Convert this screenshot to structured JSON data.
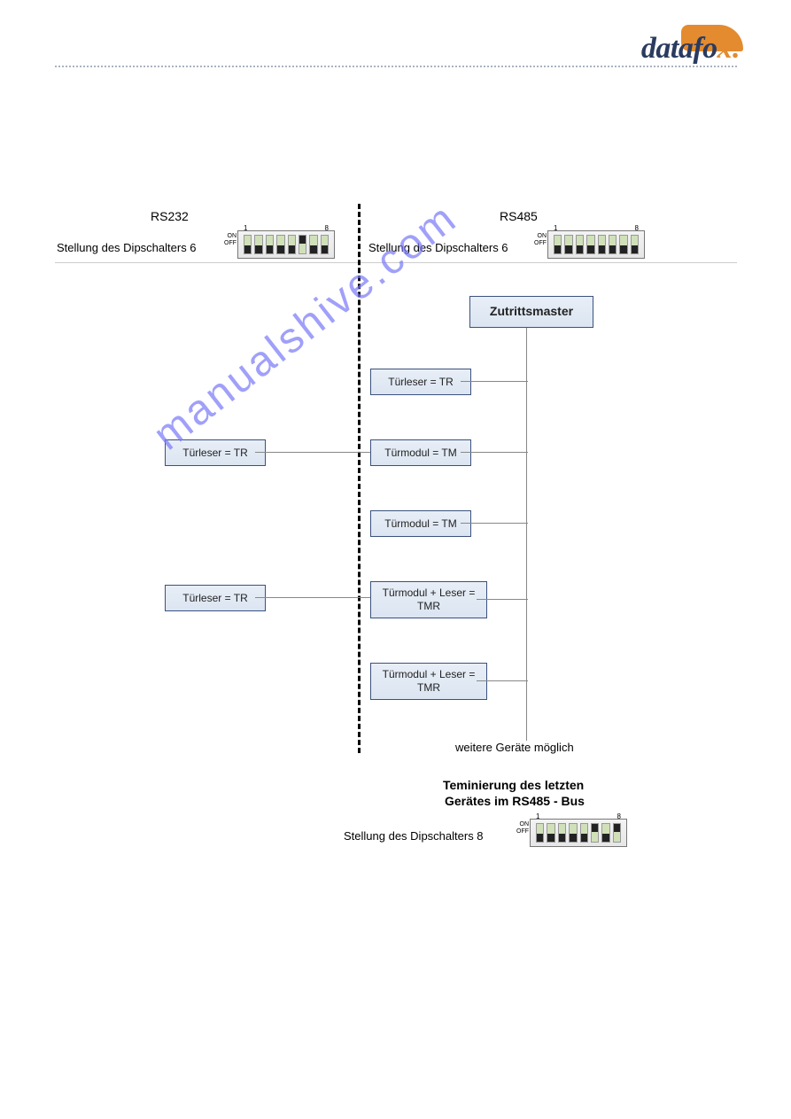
{
  "brand": {
    "word1": "datafo",
    "word2": "x"
  },
  "headers": {
    "left": "RS232",
    "right": "RS485"
  },
  "dip_label": "Stellung des Dipschalters 6",
  "dip_on": "ON",
  "dip_off": "OFF",
  "dip_start": "1",
  "dip_end": "8",
  "master": "Zutrittsmaster",
  "tr": "Türleser = TR",
  "tm": "Türmodul = TM",
  "tmr_line": "Türmodul + Leser = TMR",
  "footer_more": "weitere Geräte möglich",
  "footer_term1": "Teminierung des letzten",
  "footer_term2": "Gerätes im RS485 - Bus",
  "dip8_label": "Stellung des Dipschalters 8",
  "wm": "manualshive.com"
}
